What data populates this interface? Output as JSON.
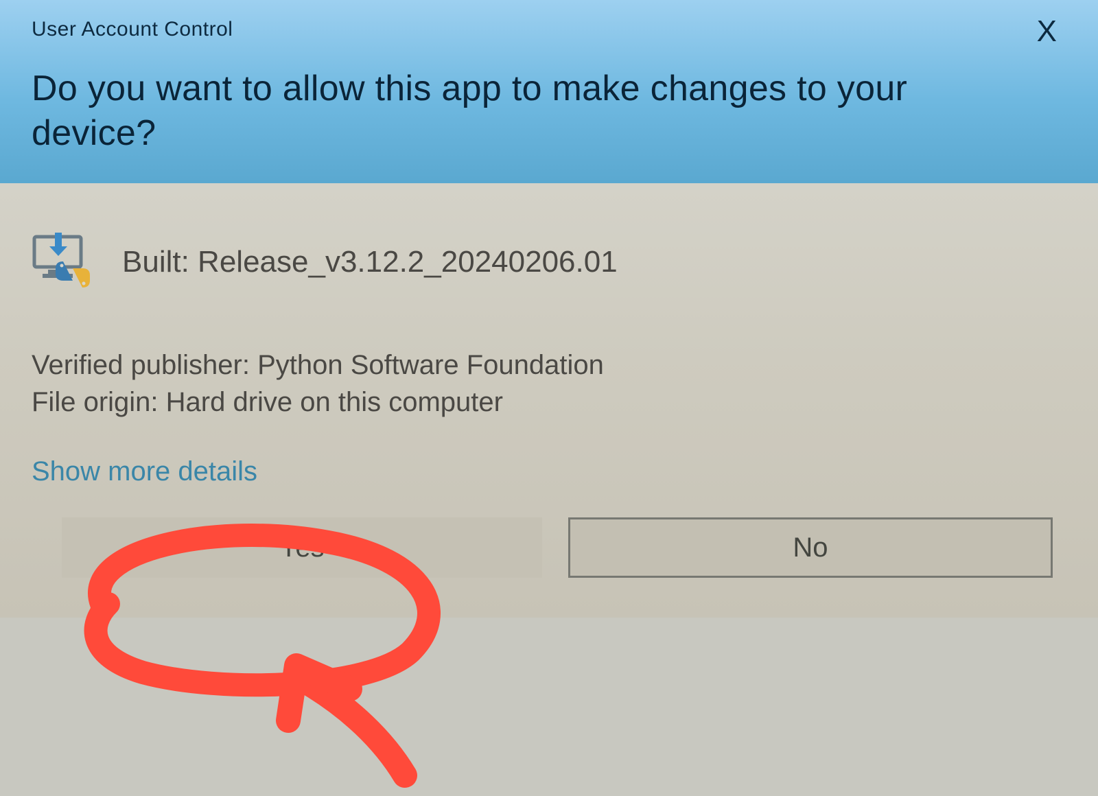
{
  "header": {
    "title": "User Account Control",
    "prompt": "Do you want to allow this app to make changes to your device?",
    "close_label": "X"
  },
  "app": {
    "name": "Built: Release_v3.12.2_20240206.01",
    "publisher_label": "Verified publisher:",
    "publisher_value": "Python Software Foundation",
    "origin_label": "File origin:",
    "origin_value": "Hard drive on this computer"
  },
  "details_link": "Show more details",
  "buttons": {
    "yes": "Yes",
    "no": "No"
  },
  "colors": {
    "header_top": "#9dd0f0",
    "header_bottom": "#5aa8d0",
    "body_bg": "#cecbbf",
    "annotation": "#ff4a3a",
    "link": "#3a86a8"
  }
}
